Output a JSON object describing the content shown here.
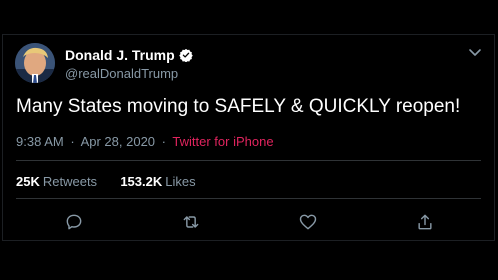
{
  "user": {
    "display_name": "Donald J. Trump",
    "handle": "@realDonaldTrump",
    "verified": true
  },
  "tweet": {
    "text": "Many States moving to SAFELY & QUICKLY reopen!",
    "time": "9:38 AM",
    "date": "Apr 28, 2020",
    "separator": "·",
    "source": "Twitter for iPhone"
  },
  "stats": {
    "retweets_count": "25K",
    "retweets_label": "Retweets",
    "likes_count": "153.2K",
    "likes_label": "Likes"
  },
  "icons": {
    "verified": "verified-badge-icon",
    "caret": "chevron-down-icon",
    "reply": "reply-icon",
    "retweet": "retweet-icon",
    "like": "heart-icon",
    "share": "share-icon"
  },
  "colors": {
    "background": "#000000",
    "text_primary": "#ffffff",
    "text_secondary": "#8899a6",
    "source_link": "#e0245e",
    "verified": "#ffffff",
    "divider": "#2f3336"
  }
}
